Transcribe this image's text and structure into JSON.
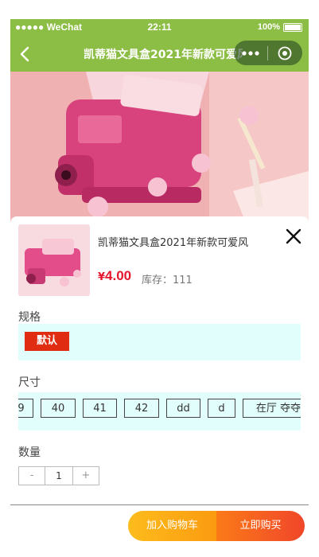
{
  "status_bar": {
    "carrier": "●●●●● WeChat",
    "time": "22:11",
    "battery": "100%"
  },
  "nav": {
    "title": "凯蒂猫文具盒2021年新款可爱风"
  },
  "product": {
    "name": "凯蒂猫文具盒2021年新款可爱风",
    "currency": "¥",
    "price": "4.00",
    "stock": "库存：111"
  },
  "spec": {
    "label": "规格",
    "options": [
      "默认"
    ],
    "selected": "默认"
  },
  "size": {
    "label": "尺寸",
    "options": [
      "9",
      "40",
      "41",
      "42",
      "dd",
      "d",
      "在厅 夺夺"
    ]
  },
  "quantity": {
    "label": "数量",
    "minus": "-",
    "value": "1",
    "plus": "+"
  },
  "actions": {
    "add_to_cart": "加入购物车",
    "buy_now": "立即购买"
  },
  "colors": {
    "brand_green": "#8cbe45",
    "price_red": "#e6162d",
    "option_active": "#e02d12",
    "option_bg": "#e1fdfc"
  }
}
